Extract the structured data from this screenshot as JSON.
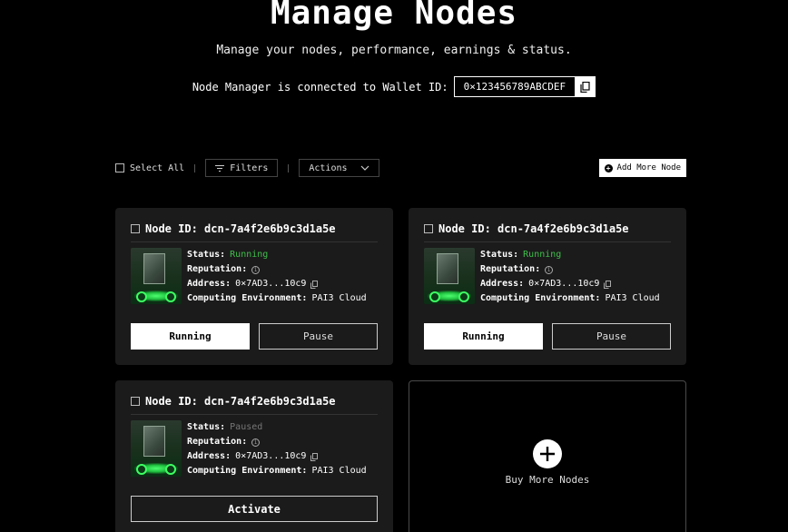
{
  "header": {
    "title": "Manage Nodes",
    "subtitle": "Manage your nodes, performance, earnings & status.",
    "wallet_label": "Node Manager is connected to Wallet ID:",
    "wallet_id": "0×123456789ABCDEF"
  },
  "toolbar": {
    "select_all": "Select All",
    "filters": "Filters",
    "actions": "Actions",
    "add_node": "Add More Node"
  },
  "labels": {
    "status": "Status:",
    "reputation": "Reputation:",
    "address": "Address:",
    "computing_environment": "Computing Environment:"
  },
  "nodes": [
    {
      "node_id": "Node ID: dcn-7a4f2e6b9c3d1a5e",
      "status": "Running",
      "address": "0×7AD3...10c9",
      "environment": "PAI3 Cloud",
      "primary_button": "Running",
      "secondary_button": "Pause"
    },
    {
      "node_id": "Node ID: dcn-7a4f2e6b9c3d1a5e",
      "status": "Running",
      "address": "0×7AD3...10c9",
      "environment": "PAI3 Cloud",
      "primary_button": "Running",
      "secondary_button": "Pause"
    },
    {
      "node_id": "Node ID: dcn-7a4f2e6b9c3d1a5e",
      "status": "Paused",
      "address": "0×7AD3...10c9",
      "environment": "PAI3 Cloud",
      "primary_button": "Activate"
    }
  ],
  "buy_more": {
    "label": "Buy More Nodes"
  },
  "colors": {
    "background": "#000000",
    "card": "#1b1b1b",
    "running": "#3fbf4b",
    "paused": "#777777"
  }
}
